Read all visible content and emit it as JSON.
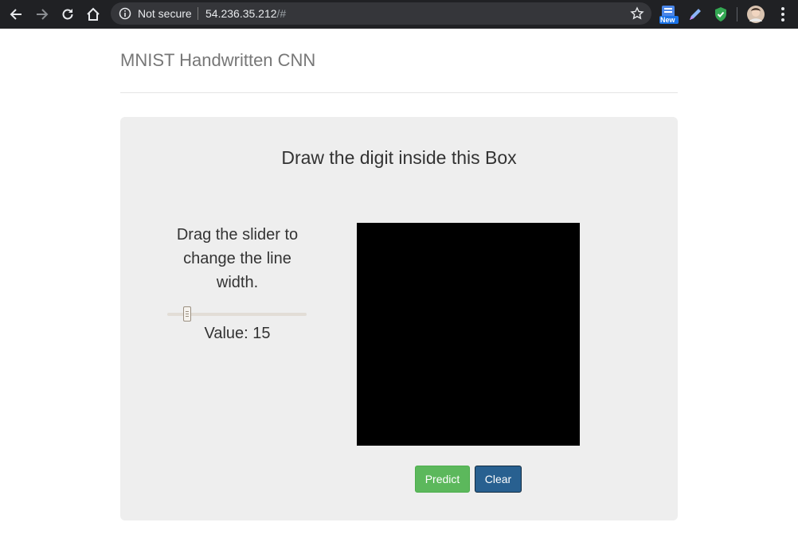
{
  "browser": {
    "security_label": "Not secure",
    "url_host": "54.236.35.212",
    "url_rest": "/#",
    "extension_badge": "New"
  },
  "page": {
    "title": "MNIST Handwritten CNN"
  },
  "panel": {
    "heading": "Draw the digit inside this Box",
    "slider_instructions": "Drag the slider to change the line width.",
    "slider_value_label": "Value:",
    "slider_value": "15",
    "predict_label": "Predict",
    "clear_label": "Clear"
  },
  "colors": {
    "chrome_bg": "#202124",
    "panel_bg": "#eeeeee",
    "canvas_bg": "#000000",
    "predict_btn": "#5cb85c",
    "clear_btn": "#286090"
  },
  "icons": [
    "back-icon",
    "forward-icon",
    "reload-icon",
    "home-icon",
    "info-icon",
    "star-icon",
    "extension-new-icon",
    "pen-extension-icon",
    "shield-extension-icon",
    "profile-avatar",
    "menu-dots-icon"
  ]
}
